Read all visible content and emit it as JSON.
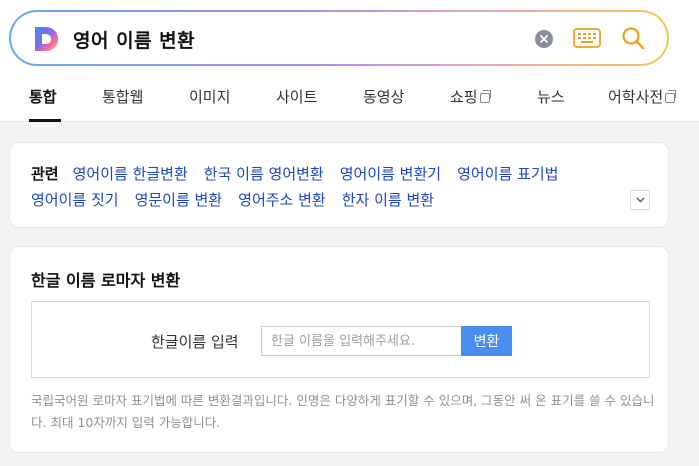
{
  "search": {
    "query": "영어 이름 변환",
    "brand_colors": [
      "#6aa8f7",
      "#a88cf0",
      "#e7a3c6",
      "#f7c94a"
    ]
  },
  "tabs": [
    {
      "label": "통합",
      "active": true
    },
    {
      "label": "통합웹"
    },
    {
      "label": "이미지"
    },
    {
      "label": "사이트"
    },
    {
      "label": "동영상"
    },
    {
      "label": "쇼핑",
      "external": true
    },
    {
      "label": "뉴스"
    },
    {
      "label": "어학사전",
      "external": true
    }
  ],
  "related": {
    "title": "관련",
    "links": [
      "영어이름 한글변환",
      "한국 이름 영어변환",
      "영어이름 변환기",
      "영어이름 표기법",
      "영어이름 짓기",
      "영문이름 변환",
      "영어주소 변환",
      "한자 이름 변환"
    ]
  },
  "converter": {
    "title": "한글 이름 로마자 변환",
    "input_label": "한글이름 입력",
    "input_placeholder": "한글 이름을 입력해주세요.",
    "button_label": "변환",
    "note": "국립국어원 로마자 표기법에 따른 변환결과입니다. 인명은 다양하게 표기할 수 있으며, 그동안 써 온 표기를 쓸 수 있습니다. 최대 10자까지 입력 가능합니다.",
    "accent_color": "#4a8ef0"
  }
}
